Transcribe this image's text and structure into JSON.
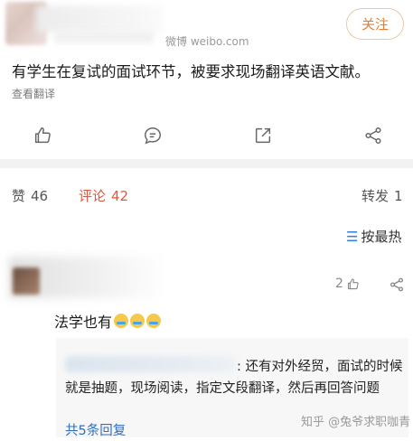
{
  "post": {
    "source": "微博 weibo.com",
    "follow_label": "关注",
    "text": "有学生在复试的面试环节，被要求现场翻译英语文献。",
    "translate_label": "查看翻译"
  },
  "actions": [
    {
      "name": "like",
      "icon": "thumbs-up-icon"
    },
    {
      "name": "comment",
      "icon": "comment-icon"
    },
    {
      "name": "repost",
      "icon": "repost-icon"
    },
    {
      "name": "share",
      "icon": "share-icon"
    }
  ],
  "stats": {
    "likes_label": "赞",
    "likes_count": "46",
    "comments_label": "评论",
    "comments_count": "42",
    "reposts_label": "转发",
    "reposts_count": "1"
  },
  "sort": {
    "label": "按最热"
  },
  "comment": {
    "likes": "2",
    "text": "法学也有",
    "reply": {
      "text": ": 还有对外经贸，面试的时候就是抽题，现场阅读，指定文段翻译，然后再回答问题",
      "more_label": "共5条回复"
    }
  },
  "watermark": "知乎 @兔爷求职咖青",
  "colors": {
    "accent": "#e0573b",
    "follow": "#e0803a",
    "link": "#2f6fbd"
  }
}
